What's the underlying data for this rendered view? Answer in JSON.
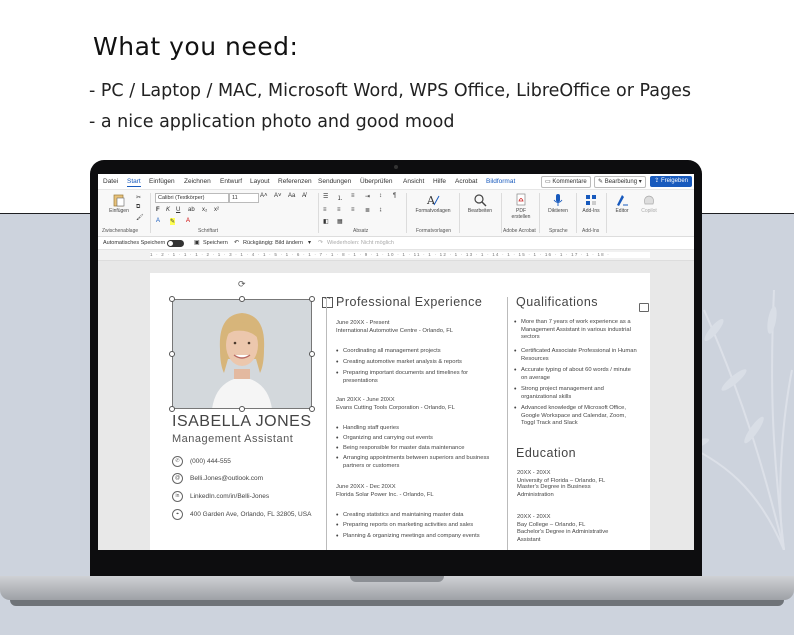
{
  "heading": "What you need:",
  "bullets": [
    "- PC / Laptop / MAC, Microsoft Word, WPS Office, LibreOffice or Pages",
    "- a nice application photo and good mood"
  ],
  "word": {
    "menu": [
      "Datei",
      "Start",
      "Einfügen",
      "Zeichnen",
      "Entwurf",
      "Layout",
      "Referenzen",
      "Sendungen",
      "Überprüfen",
      "Ansicht",
      "Hilfe",
      "Acrobat",
      "Bildformat"
    ],
    "active_menu": "Start",
    "comments_button": "Kommentare",
    "editing_button": "Bearbeitung",
    "share_button": "Freigeben",
    "ribbon": {
      "paste": "Einfügen",
      "font_name": "Calibri (Textkörper)",
      "font_size": "11",
      "styles": "Formatvorlagen",
      "edit": "Bearbeiten",
      "pdf": "PDF erstellen",
      "dictate": "Diktieren",
      "addins": "Add-Ins",
      "editor": "Editor",
      "copilot": "Copilot",
      "groups": {
        "clipboard": "Zwischenablage",
        "font": "Schriftart",
        "paragraph": "Absatz",
        "styles": "Formatvorlagen",
        "acrobat": "Adobe Acrobat",
        "voice": "Sprache",
        "addins": "Add-Ins"
      }
    },
    "qat": {
      "autosave": "Automatisches Speichern",
      "save": "Speichern",
      "undo": "Rückgängig: Bild ändern",
      "redo": "Wiederholen: Nicht möglich"
    },
    "ruler": "1 · 2 · 1 · 1 · 1 · 2 · 1 · 3 · 1 · 4 · 1 · 5 · 1 · 6 · 1 · 7 · 1 · 8 · 1 · 9 · 1 · 10 · 1 · 11 · 1 · 12 · 1 · 13 · 1 · 14 · 1 · 15 · 1 · 16 · 1 · 17 · 1 · 18 ·"
  },
  "resume": {
    "name": "ISABELLA JONES",
    "title": "Management Assistant",
    "contacts": [
      {
        "icon": "phone-icon",
        "glyph": "✆",
        "text": "(000) 444-555"
      },
      {
        "icon": "email-icon",
        "glyph": "@",
        "text": "Belli.Jones@outlook.com"
      },
      {
        "icon": "linkedin-icon",
        "glyph": "in",
        "text": "LinkedIn.com/in/Belli-Jones"
      },
      {
        "icon": "location-icon",
        "glyph": "⌖",
        "text": "400 Garden Ave, Orlando, FL 32805, USA"
      }
    ],
    "experience_heading": "Professional Experience",
    "jobs": [
      {
        "dates": "June 20XX - Present",
        "company": "International Automotive Centre - Orlando, FL",
        "bullets": [
          "Coordinating all management projects",
          "Creating automotive market analysis & reports",
          "Preparing important documents and timelines for presentations"
        ]
      },
      {
        "dates": "Jan 20XX - June 20XX",
        "company": "Evans Cutting Tools Corporation - Orlando, FL",
        "bullets": [
          "Handling staff queries",
          "Organizing and carrying out events",
          "Being responsible for master data maintenance",
          "Arranging appointments between superiors and business partners or customers"
        ]
      },
      {
        "dates": "June 20XX - Dec 20XX",
        "company": "Florida Solar Power Inc. - Orlando, FL",
        "bullets": [
          "Creating statistics and maintaining master data",
          "Preparing reports on marketing activities and sales",
          "Planning & organizing meetings and company events"
        ]
      }
    ],
    "qualifications_heading": "Qualifications",
    "qualifications": [
      "More than 7 years of work experience as a Management Assistant in various industrial sectors",
      "Certificated Associate Professional in Human Resources",
      "Accurate typing of about 60 words / minute on average",
      "Strong project management and organizational skills",
      "Advanced knowledge of Microsoft Office, Google Workspace and Calendar, Zoom, Toggl Track and Slack"
    ],
    "education_heading": "Education",
    "education": [
      {
        "dates": "20XX - 20XX",
        "school": "University of Florida – Orlando, FL",
        "degree": "Master's Degree in Business Administration"
      },
      {
        "dates": "20XX - 20XX",
        "school": "Bay College – Orlando, FL",
        "degree": "Bachelor's Degree in Administrative Assistant"
      }
    ]
  },
  "colors": {
    "word_blue": "#185abd",
    "backdrop": "#cdd3dd",
    "laptop_bezel": "#0d0d0f"
  }
}
